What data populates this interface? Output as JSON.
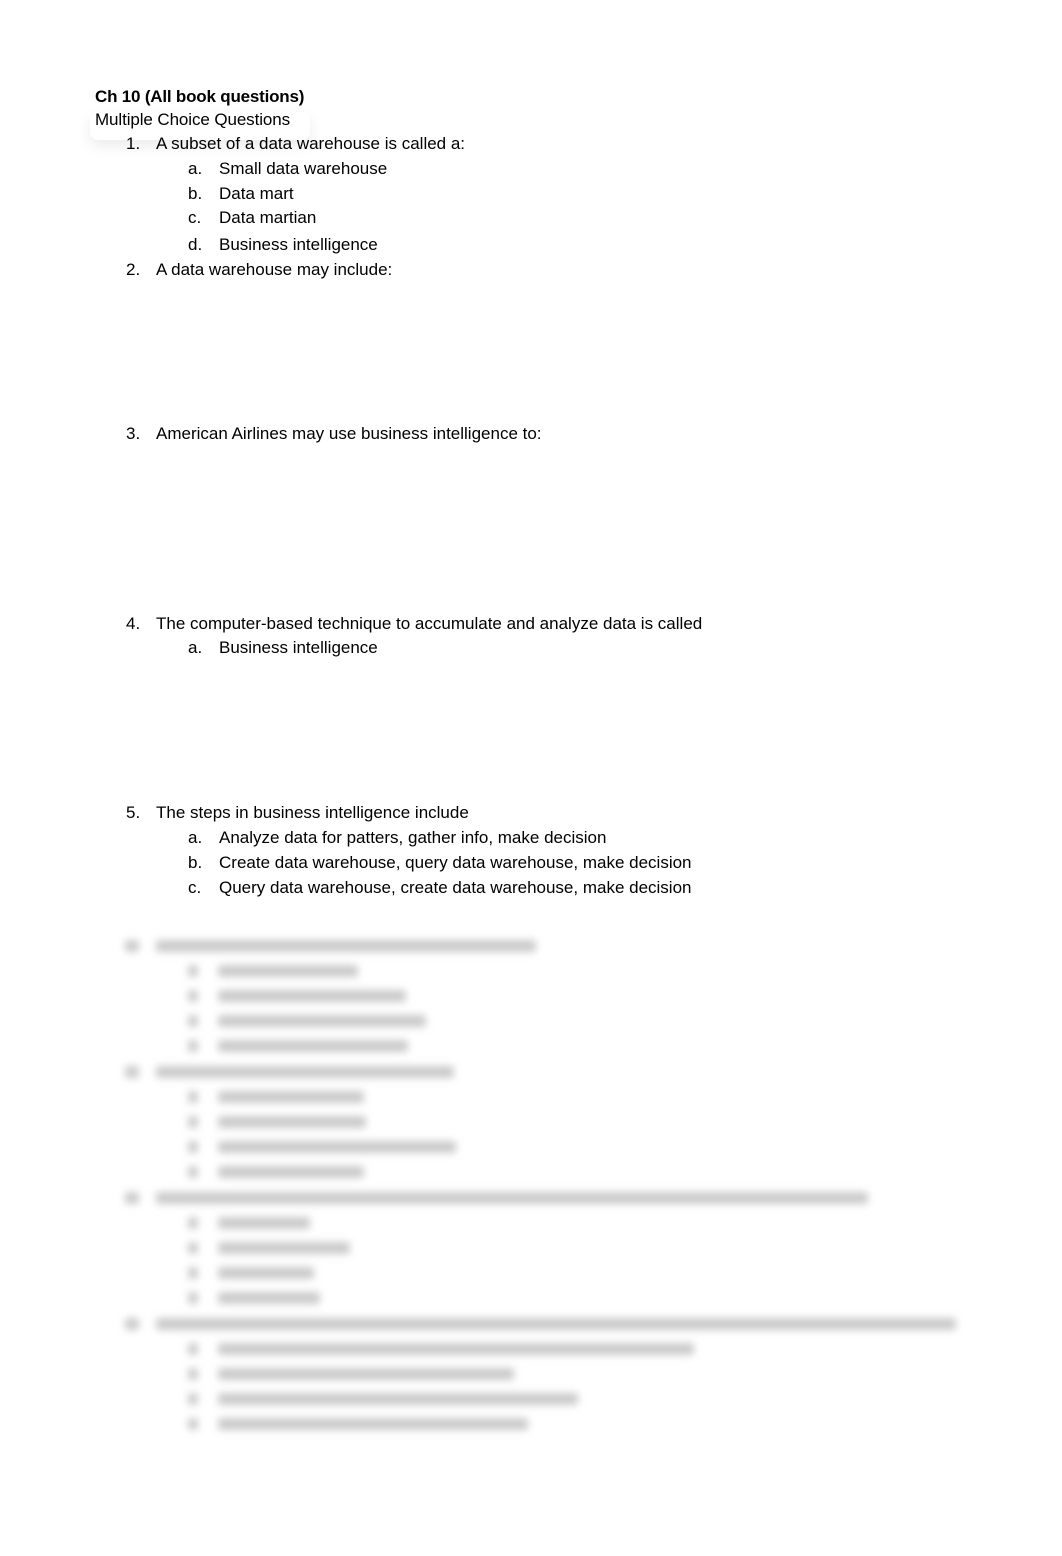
{
  "document": {
    "title": "Ch 10 (All book questions)",
    "subtitle": "Multiple Choice Questions",
    "questions": [
      {
        "number": "1.",
        "text": "A subset of a data warehouse is called a:",
        "options": [
          {
            "letter": "a.",
            "text": "Small data warehouse"
          },
          {
            "letter": "b.",
            "text": "Data mart"
          },
          {
            "letter": "c.",
            "text": "Data martian"
          },
          {
            "letter": "d.",
            "text": "Business intelligence"
          }
        ]
      },
      {
        "number": "2.",
        "text": "A data warehouse may include:",
        "options": []
      },
      {
        "number": "3.",
        "text": "American Airlines may use business intelligence to:",
        "options": []
      },
      {
        "number": "4.",
        "text": "The computer-based technique to accumulate and analyze data is called",
        "options": [
          {
            "letter": "a.",
            "text": "Business intelligence"
          }
        ]
      },
      {
        "number": "5.",
        "text": "The steps in business intelligence include",
        "options": [
          {
            "letter": "a.",
            "text": "Analyze data for patters, gather info, make decision"
          },
          {
            "letter": "b.",
            "text": "Create data warehouse, query data warehouse, make decision"
          },
          {
            "letter": "c.",
            "text": "Query data warehouse, create data warehouse, make decision"
          }
        ]
      }
    ],
    "obscured_section": "blurred"
  }
}
